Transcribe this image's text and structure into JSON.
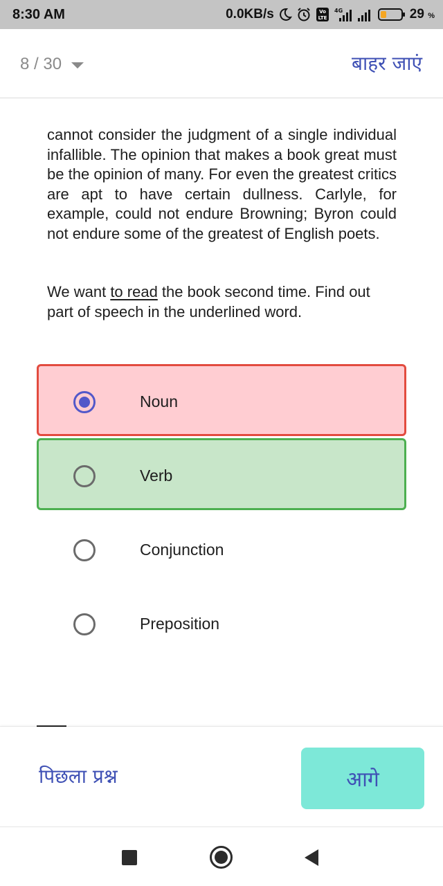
{
  "status_bar": {
    "time": "8:30 AM",
    "network_speed": "0.0KB/s",
    "network_type": "4G",
    "volte_label": "Vo LTE",
    "battery_percent": "29",
    "battery_unit": "%",
    "icons": [
      "moon-icon",
      "alarm-icon",
      "volte-icon",
      "signal-4g-icon",
      "signal-icon",
      "battery-icon"
    ]
  },
  "header": {
    "question_counter": "8 / 30",
    "exit_label": "बाहर जाएं"
  },
  "passage": {
    "text": "cannot consider the judgment of a single individual infallible. The opinion that makes a book great must be the opinion of many. For even the greatest critics are apt to have certain dullness. Carlyle, for example, could not endure Browning; Byron could not endure some of the greatest of English poets."
  },
  "question": {
    "before": "We want ",
    "underlined": "to read",
    "after": " the book second time. Find out part of speech in the underlined word."
  },
  "options": [
    {
      "label": "Noun",
      "selected": true,
      "state": "wrong"
    },
    {
      "label": "Verb",
      "selected": false,
      "state": "correct"
    },
    {
      "label": "Conjunction",
      "selected": false,
      "state": "none"
    },
    {
      "label": "Preposition",
      "selected": false,
      "state": "none"
    }
  ],
  "footer": {
    "previous_label": "पिछला प्रश्न",
    "next_label": "आगे"
  },
  "colors": {
    "accent": "#3f51b5",
    "wrong_bg": "#ffcdd2",
    "wrong_border": "#e24b3f",
    "correct_bg": "#c8e6c9",
    "correct_border": "#4caf50",
    "next_button_bg": "#7de8d8",
    "radio_selected": "#5258c9"
  },
  "nav_bar": {
    "icons": [
      "recents-square-icon",
      "home-circle-icon",
      "back-triangle-icon"
    ]
  }
}
